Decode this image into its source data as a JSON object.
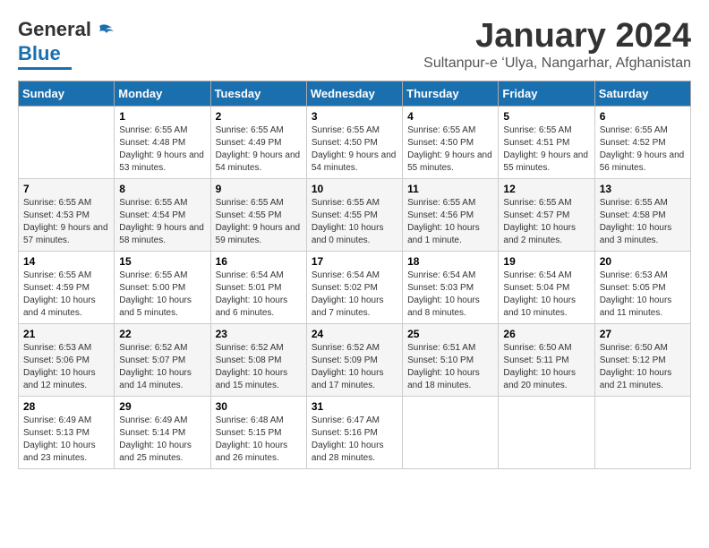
{
  "header": {
    "logo_general": "General",
    "logo_blue": "Blue",
    "month_title": "January 2024",
    "subtitle": "Sultanpur-e ʻUlya, Nangarhar, Afghanistan"
  },
  "days_of_week": [
    "Sunday",
    "Monday",
    "Tuesday",
    "Wednesday",
    "Thursday",
    "Friday",
    "Saturday"
  ],
  "weeks": [
    [
      {
        "day": "",
        "info": ""
      },
      {
        "day": "1",
        "sunrise": "Sunrise: 6:55 AM",
        "sunset": "Sunset: 4:48 PM",
        "daylight": "Daylight: 9 hours and 53 minutes."
      },
      {
        "day": "2",
        "sunrise": "Sunrise: 6:55 AM",
        "sunset": "Sunset: 4:49 PM",
        "daylight": "Daylight: 9 hours and 54 minutes."
      },
      {
        "day": "3",
        "sunrise": "Sunrise: 6:55 AM",
        "sunset": "Sunset: 4:50 PM",
        "daylight": "Daylight: 9 hours and 54 minutes."
      },
      {
        "day": "4",
        "sunrise": "Sunrise: 6:55 AM",
        "sunset": "Sunset: 4:50 PM",
        "daylight": "Daylight: 9 hours and 55 minutes."
      },
      {
        "day": "5",
        "sunrise": "Sunrise: 6:55 AM",
        "sunset": "Sunset: 4:51 PM",
        "daylight": "Daylight: 9 hours and 55 minutes."
      },
      {
        "day": "6",
        "sunrise": "Sunrise: 6:55 AM",
        "sunset": "Sunset: 4:52 PM",
        "daylight": "Daylight: 9 hours and 56 minutes."
      }
    ],
    [
      {
        "day": "7",
        "sunrise": "Sunrise: 6:55 AM",
        "sunset": "Sunset: 4:53 PM",
        "daylight": "Daylight: 9 hours and 57 minutes."
      },
      {
        "day": "8",
        "sunrise": "Sunrise: 6:55 AM",
        "sunset": "Sunset: 4:54 PM",
        "daylight": "Daylight: 9 hours and 58 minutes."
      },
      {
        "day": "9",
        "sunrise": "Sunrise: 6:55 AM",
        "sunset": "Sunset: 4:55 PM",
        "daylight": "Daylight: 9 hours and 59 minutes."
      },
      {
        "day": "10",
        "sunrise": "Sunrise: 6:55 AM",
        "sunset": "Sunset: 4:55 PM",
        "daylight": "Daylight: 10 hours and 0 minutes."
      },
      {
        "day": "11",
        "sunrise": "Sunrise: 6:55 AM",
        "sunset": "Sunset: 4:56 PM",
        "daylight": "Daylight: 10 hours and 1 minute."
      },
      {
        "day": "12",
        "sunrise": "Sunrise: 6:55 AM",
        "sunset": "Sunset: 4:57 PM",
        "daylight": "Daylight: 10 hours and 2 minutes."
      },
      {
        "day": "13",
        "sunrise": "Sunrise: 6:55 AM",
        "sunset": "Sunset: 4:58 PM",
        "daylight": "Daylight: 10 hours and 3 minutes."
      }
    ],
    [
      {
        "day": "14",
        "sunrise": "Sunrise: 6:55 AM",
        "sunset": "Sunset: 4:59 PM",
        "daylight": "Daylight: 10 hours and 4 minutes."
      },
      {
        "day": "15",
        "sunrise": "Sunrise: 6:55 AM",
        "sunset": "Sunset: 5:00 PM",
        "daylight": "Daylight: 10 hours and 5 minutes."
      },
      {
        "day": "16",
        "sunrise": "Sunrise: 6:54 AM",
        "sunset": "Sunset: 5:01 PM",
        "daylight": "Daylight: 10 hours and 6 minutes."
      },
      {
        "day": "17",
        "sunrise": "Sunrise: 6:54 AM",
        "sunset": "Sunset: 5:02 PM",
        "daylight": "Daylight: 10 hours and 7 minutes."
      },
      {
        "day": "18",
        "sunrise": "Sunrise: 6:54 AM",
        "sunset": "Sunset: 5:03 PM",
        "daylight": "Daylight: 10 hours and 8 minutes."
      },
      {
        "day": "19",
        "sunrise": "Sunrise: 6:54 AM",
        "sunset": "Sunset: 5:04 PM",
        "daylight": "Daylight: 10 hours and 10 minutes."
      },
      {
        "day": "20",
        "sunrise": "Sunrise: 6:53 AM",
        "sunset": "Sunset: 5:05 PM",
        "daylight": "Daylight: 10 hours and 11 minutes."
      }
    ],
    [
      {
        "day": "21",
        "sunrise": "Sunrise: 6:53 AM",
        "sunset": "Sunset: 5:06 PM",
        "daylight": "Daylight: 10 hours and 12 minutes."
      },
      {
        "day": "22",
        "sunrise": "Sunrise: 6:52 AM",
        "sunset": "Sunset: 5:07 PM",
        "daylight": "Daylight: 10 hours and 14 minutes."
      },
      {
        "day": "23",
        "sunrise": "Sunrise: 6:52 AM",
        "sunset": "Sunset: 5:08 PM",
        "daylight": "Daylight: 10 hours and 15 minutes."
      },
      {
        "day": "24",
        "sunrise": "Sunrise: 6:52 AM",
        "sunset": "Sunset: 5:09 PM",
        "daylight": "Daylight: 10 hours and 17 minutes."
      },
      {
        "day": "25",
        "sunrise": "Sunrise: 6:51 AM",
        "sunset": "Sunset: 5:10 PM",
        "daylight": "Daylight: 10 hours and 18 minutes."
      },
      {
        "day": "26",
        "sunrise": "Sunrise: 6:50 AM",
        "sunset": "Sunset: 5:11 PM",
        "daylight": "Daylight: 10 hours and 20 minutes."
      },
      {
        "day": "27",
        "sunrise": "Sunrise: 6:50 AM",
        "sunset": "Sunset: 5:12 PM",
        "daylight": "Daylight: 10 hours and 21 minutes."
      }
    ],
    [
      {
        "day": "28",
        "sunrise": "Sunrise: 6:49 AM",
        "sunset": "Sunset: 5:13 PM",
        "daylight": "Daylight: 10 hours and 23 minutes."
      },
      {
        "day": "29",
        "sunrise": "Sunrise: 6:49 AM",
        "sunset": "Sunset: 5:14 PM",
        "daylight": "Daylight: 10 hours and 25 minutes."
      },
      {
        "day": "30",
        "sunrise": "Sunrise: 6:48 AM",
        "sunset": "Sunset: 5:15 PM",
        "daylight": "Daylight: 10 hours and 26 minutes."
      },
      {
        "day": "31",
        "sunrise": "Sunrise: 6:47 AM",
        "sunset": "Sunset: 5:16 PM",
        "daylight": "Daylight: 10 hours and 28 minutes."
      },
      {
        "day": "",
        "info": ""
      },
      {
        "day": "",
        "info": ""
      },
      {
        "day": "",
        "info": ""
      }
    ]
  ]
}
